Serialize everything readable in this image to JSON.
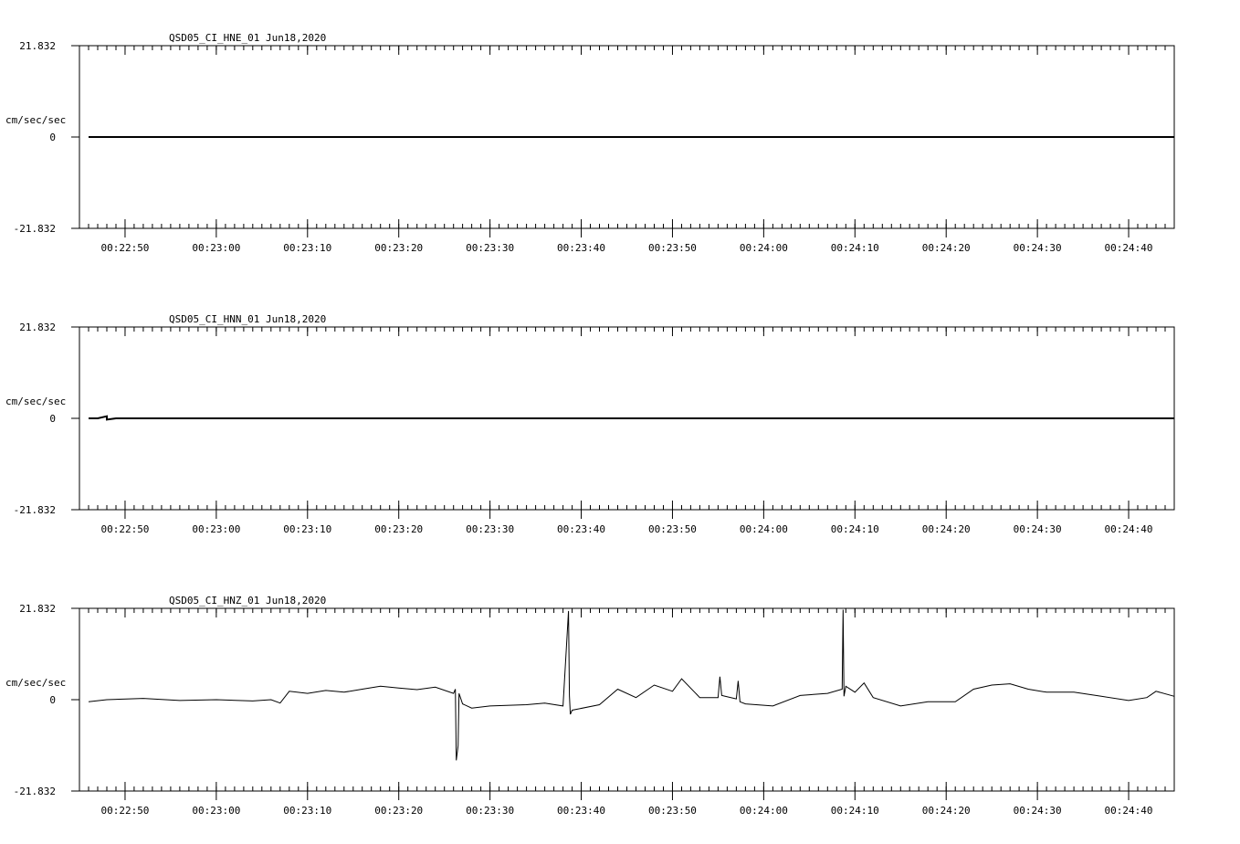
{
  "chart_data": [
    {
      "type": "line",
      "title": "QSD05_CI_HNE_01  Jun18,2020",
      "ylabel": "cm/sec/sec",
      "ylim": [
        -21.832,
        21.832
      ],
      "yticks": [
        "21.832",
        "0",
        "-21.832"
      ],
      "x_time_range": [
        "00:22:45",
        "00:24:45"
      ],
      "xtick_labels": [
        "00:22:50",
        "00:23:00",
        "00:23:10",
        "00:23:20",
        "00:23:30",
        "00:23:40",
        "00:23:50",
        "00:24:00",
        "00:24:10",
        "00:24:20",
        "00:24:30",
        "00:24:40"
      ],
      "trace_start": "00:22:46",
      "series": [
        {
          "x": [
            "00:22:46",
            "00:23:00",
            "00:23:20",
            "00:23:40",
            "00:24:00",
            "00:24:20",
            "00:24:45"
          ],
          "y": [
            0,
            0,
            0,
            0,
            0,
            0,
            0
          ]
        }
      ]
    },
    {
      "type": "line",
      "title": "QSD05_CI_HNN_01  Jun18,2020",
      "ylabel": "cm/sec/sec",
      "ylim": [
        -21.832,
        21.832
      ],
      "yticks": [
        "21.832",
        "0",
        "-21.832"
      ],
      "x_time_range": [
        "00:22:45",
        "00:24:45"
      ],
      "xtick_labels": [
        "00:22:50",
        "00:23:00",
        "00:23:10",
        "00:23:20",
        "00:23:30",
        "00:23:40",
        "00:23:50",
        "00:24:00",
        "00:24:10",
        "00:24:20",
        "00:24:30",
        "00:24:40"
      ],
      "trace_start": "00:22:46",
      "series": [
        {
          "x": [
            "00:22:46",
            "00:22:47",
            "00:22:48",
            "00:22:48",
            "00:22:49",
            "00:23:00",
            "00:23:20",
            "00:23:40",
            "00:24:00",
            "00:24:20",
            "00:24:45"
          ],
          "y": [
            0,
            0,
            0.5,
            -0.3,
            0,
            0,
            0,
            0,
            0,
            0,
            0
          ]
        }
      ]
    },
    {
      "type": "line",
      "title": "QSD05_CI_HNZ_01  Jun18,2020",
      "ylabel": "cm/sec/sec",
      "ylim": [
        -21.832,
        21.832
      ],
      "yticks": [
        "21.832",
        "0",
        "-21.832"
      ],
      "x_time_range": [
        "00:22:45",
        "00:24:45"
      ],
      "xtick_labels": [
        "00:22:50",
        "00:23:00",
        "00:23:10",
        "00:23:20",
        "00:23:30",
        "00:23:40",
        "00:23:50",
        "00:24:00",
        "00:24:10",
        "00:24:20",
        "00:24:30",
        "00:24:40"
      ],
      "trace_start": "00:22:46",
      "series": [
        {
          "x": [
            "00:22:46",
            "00:22:48",
            "00:22:52",
            "00:22:56",
            "00:23:00",
            "00:23:04",
            "00:23:06",
            "00:23:07",
            "00:23:08",
            "00:23:10",
            "00:23:12",
            "00:23:14",
            "00:23:16",
            "00:23:18",
            "00:23:20",
            "00:23:22",
            "00:23:24",
            "00:23:26",
            "00:23:26.2",
            "00:23:26.3",
            "00:23:26.5",
            "00:23:26.6",
            "00:23:27",
            "00:23:28",
            "00:23:30",
            "00:23:34",
            "00:23:36",
            "00:23:38",
            "00:23:38.6",
            "00:23:38.7",
            "00:23:38.8",
            "00:23:39",
            "00:23:42",
            "00:23:44",
            "00:23:46",
            "00:23:48",
            "00:23:50",
            "00:23:51",
            "00:23:53",
            "00:23:55",
            "00:23:55.2",
            "00:23:55.4",
            "00:23:57",
            "00:23:57.2",
            "00:23:57.4",
            "00:23:58",
            "00:24:01",
            "00:24:04",
            "00:24:07",
            "00:24:08.6",
            "00:24:08.7",
            "00:24:08.8",
            "00:24:09",
            "00:24:10",
            "00:24:11",
            "00:24:12",
            "00:24:15",
            "00:24:18",
            "00:24:21",
            "00:24:23",
            "00:24:25",
            "00:24:27",
            "00:24:29",
            "00:24:31",
            "00:24:34",
            "00:24:37",
            "00:24:40",
            "00:24:42",
            "00:24:43",
            "00:24:45"
          ],
          "y": [
            -0.5,
            0,
            0.3,
            -0.2,
            0,
            -0.3,
            0,
            -0.8,
            2.0,
            1.5,
            2.2,
            1.8,
            2.5,
            3.2,
            2.8,
            2.4,
            3.0,
            1.5,
            2.5,
            -14.5,
            -11.0,
            1.5,
            -1.0,
            -2.0,
            -1.5,
            -1.2,
            -0.8,
            -1.5,
            21.2,
            1.0,
            -3.5,
            -2.5,
            -1.2,
            2.5,
            0.5,
            3.5,
            2.0,
            5.0,
            0.5,
            0.5,
            5.5,
            1.0,
            0.2,
            4.5,
            -0.5,
            -1.0,
            -1.5,
            1.0,
            1.5,
            2.5,
            21.5,
            0.8,
            3.2,
            1.8,
            4.0,
            0.5,
            -1.5,
            -0.5,
            -0.5,
            2.5,
            3.5,
            3.8,
            2.5,
            1.8,
            1.8,
            0.8,
            -0.2,
            0.5,
            2.0,
            0.8
          ]
        }
      ]
    }
  ]
}
